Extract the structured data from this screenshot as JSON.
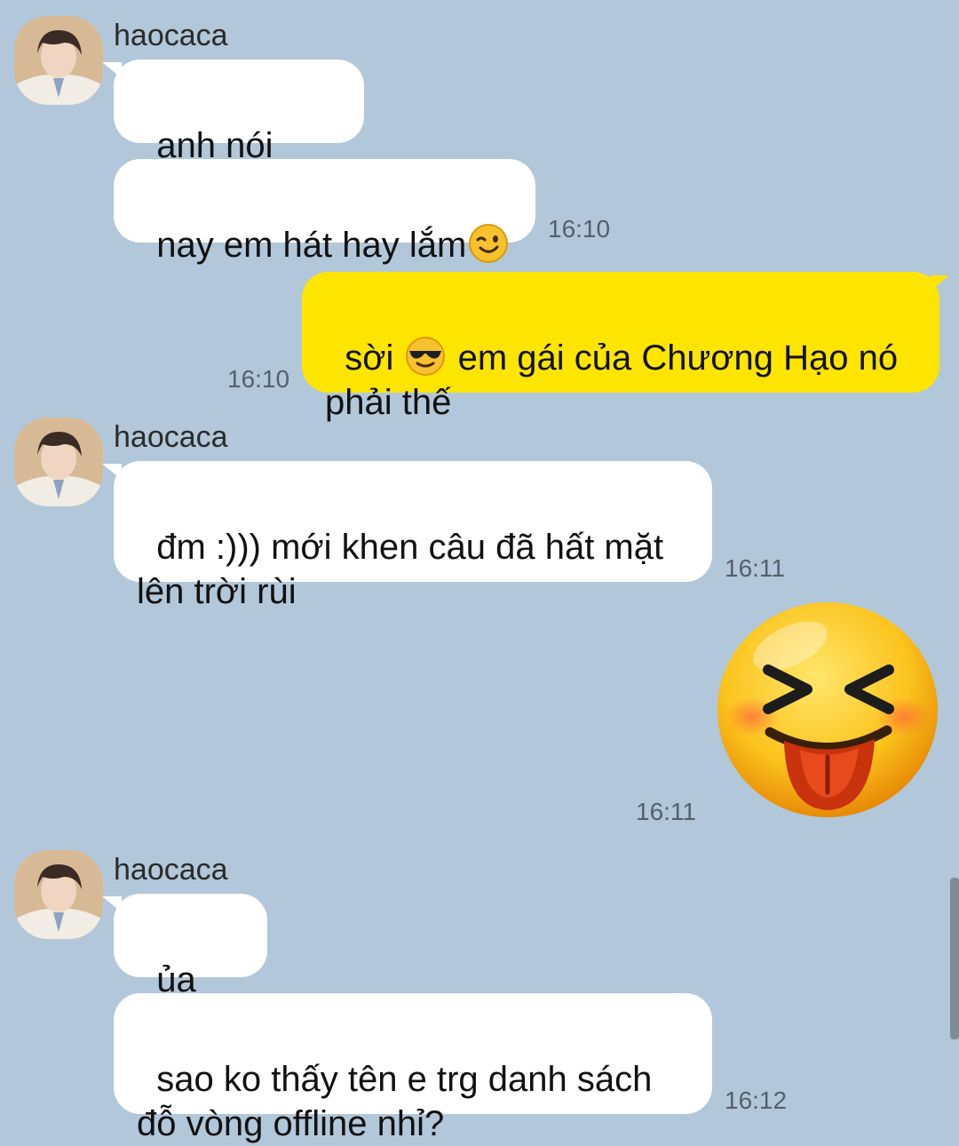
{
  "chat": {
    "group1": {
      "sender": "haocaca",
      "messages": [
        {
          "text": "anh nói thật"
        },
        {
          "text": "nay em hát hay lắm",
          "emoji": "wink-emoji",
          "time": "16:10"
        }
      ]
    },
    "outgoing1": {
      "text_before": "sời ",
      "emoji": "sunglasses-emoji",
      "text_after": " em gái của Chương Hạo nó phải thế",
      "time": "16:10"
    },
    "group2": {
      "sender": "haocaca",
      "messages": [
        {
          "text": "đm :))) mới khen câu đã hất mặt lên trời rùi",
          "time": "16:11"
        }
      ]
    },
    "outgoing2": {
      "sticker": "tongue-out-squint-emoji",
      "time": "16:11"
    },
    "group3": {
      "sender": "haocaca",
      "messages": [
        {
          "text": "ủa mà"
        },
        {
          "text": "sao ko thấy tên e trg danh sách đỗ vòng offline nhỉ?",
          "time": "16:12"
        }
      ]
    }
  },
  "colors": {
    "background": "#b2c7da",
    "incoming_bubble": "#ffffff",
    "outgoing_bubble": "#fee500",
    "timestamp": "#55606b"
  }
}
